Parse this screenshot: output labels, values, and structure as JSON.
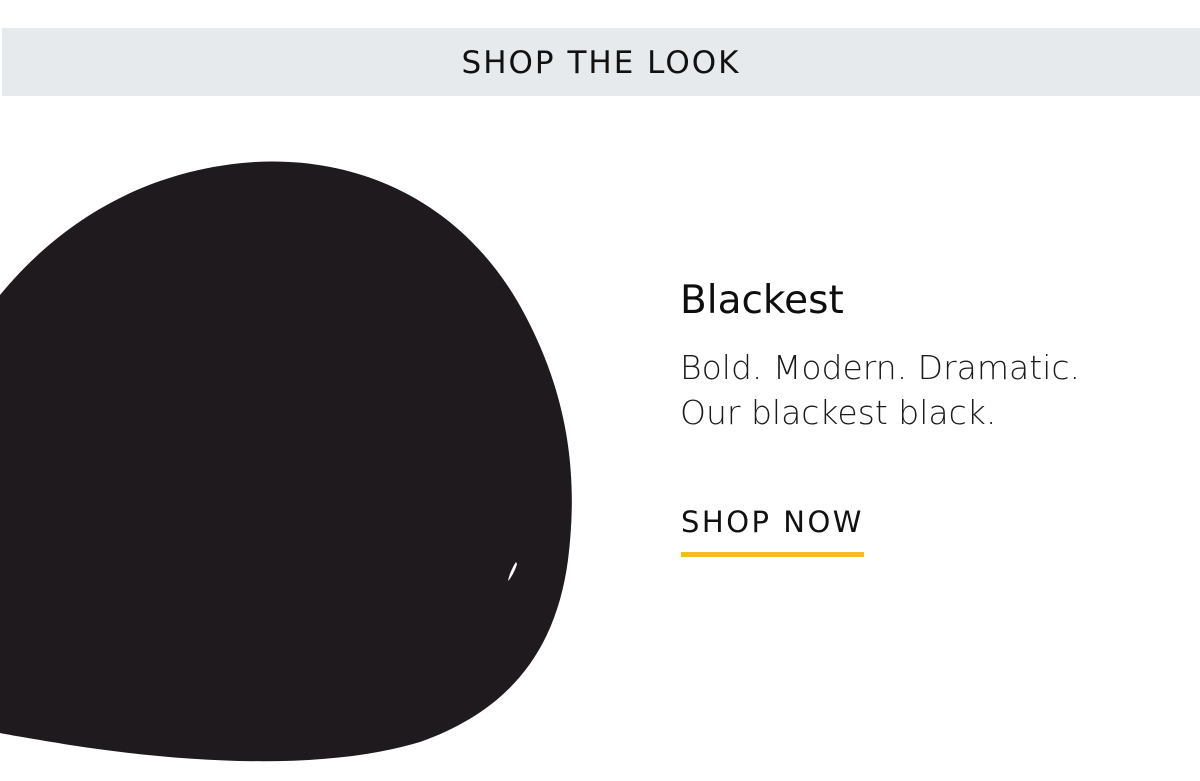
{
  "banner": {
    "title": "SHOP THE LOOK",
    "background_color": "#e7eaed"
  },
  "product": {
    "name": "Blackest",
    "description_lines": [
      "Bold. Modern. Dramatic.",
      "Our blackest black."
    ],
    "swatch_color": "#1e1a1d"
  },
  "cta": {
    "label": "SHOP NOW",
    "underline_color": "#f0be24"
  }
}
